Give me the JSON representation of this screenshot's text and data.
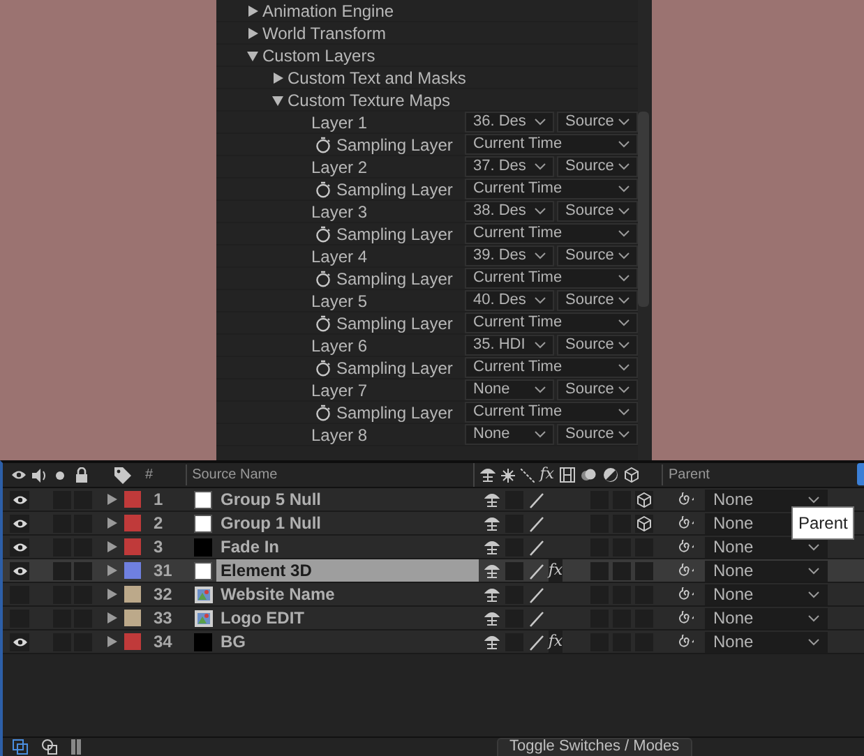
{
  "effect_controls": {
    "items": [
      {
        "label": "Animation Engine",
        "expanded": false
      },
      {
        "label": "World Transform",
        "expanded": false
      },
      {
        "label": "Custom Layers",
        "expanded": true,
        "children": [
          {
            "label": "Custom Text and Masks",
            "expanded": false
          },
          {
            "label": "Custom Texture Maps",
            "expanded": true,
            "children": [
              {
                "kind": "layer",
                "label": "Layer 1",
                "value": "36. Des",
                "mode": "Source"
              },
              {
                "kind": "sampling",
                "label": "Sampling Layer",
                "value": "Current Time"
              },
              {
                "kind": "layer",
                "label": "Layer 2",
                "value": "37. Des",
                "mode": "Source"
              },
              {
                "kind": "sampling",
                "label": "Sampling Layer",
                "value": "Current Time"
              },
              {
                "kind": "layer",
                "label": "Layer 3",
                "value": "38. Des",
                "mode": "Source"
              },
              {
                "kind": "sampling",
                "label": "Sampling Layer",
                "value": "Current Time"
              },
              {
                "kind": "layer",
                "label": "Layer 4",
                "value": "39. Des",
                "mode": "Source"
              },
              {
                "kind": "sampling",
                "label": "Sampling Layer",
                "value": "Current Time"
              },
              {
                "kind": "layer",
                "label": "Layer 5",
                "value": "40. Des",
                "mode": "Source"
              },
              {
                "kind": "sampling",
                "label": "Sampling Layer",
                "value": "Current Time"
              },
              {
                "kind": "layer",
                "label": "Layer 6",
                "value": "35. HDI",
                "mode": "Source"
              },
              {
                "kind": "sampling",
                "label": "Sampling Layer",
                "value": "Current Time"
              },
              {
                "kind": "layer",
                "label": "Layer 7",
                "value": "None",
                "mode": "Source"
              },
              {
                "kind": "sampling",
                "label": "Sampling Layer",
                "value": "Current Time"
              },
              {
                "kind": "layer",
                "label": "Layer 8",
                "value": "None",
                "mode": "Source"
              }
            ]
          }
        ]
      }
    ]
  },
  "timeline": {
    "columns": {
      "number": "#",
      "source_name": "Source Name",
      "fx": "fx",
      "parent": "Parent"
    },
    "layers": [
      {
        "kind": "white_solid",
        "number": "1",
        "name": "Group 5 Null",
        "color": "#c03a3a",
        "visible": true,
        "selected": false,
        "three_d": true,
        "parent": "None"
      },
      {
        "kind": "white_solid",
        "number": "2",
        "name": "Group 1 Null",
        "color": "#c03a3a",
        "visible": true,
        "selected": false,
        "three_d": true,
        "parent": "None"
      },
      {
        "kind": "black_solid",
        "number": "3",
        "name": "Fade In",
        "color": "#c03a3a",
        "visible": true,
        "selected": false,
        "three_d": false,
        "parent": "None"
      },
      {
        "kind": "white_solid",
        "number": "31",
        "name": "Element 3D",
        "color": "#6f80e0",
        "visible": true,
        "selected": true,
        "fx": "fx",
        "three_d": false,
        "parent": "None"
      },
      {
        "kind": "footage",
        "number": "32",
        "name": "Website Name",
        "color": "#bca98a",
        "visible": false,
        "selected": false,
        "three_d": false,
        "parent": "None"
      },
      {
        "kind": "footage",
        "number": "33",
        "name": "Logo EDIT",
        "color": "#bca98a",
        "visible": false,
        "selected": false,
        "three_d": false,
        "parent": "None"
      },
      {
        "kind": "black_solid",
        "number": "34",
        "name": "BG",
        "color": "#c03a3a",
        "visible": true,
        "selected": false,
        "fx": "fx",
        "three_d": false,
        "parent": "None"
      }
    ],
    "tooltip": "Parent",
    "toggle_button": "Toggle Switches / Modes"
  }
}
